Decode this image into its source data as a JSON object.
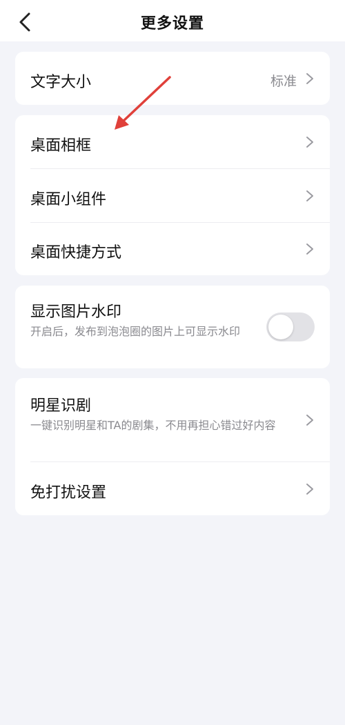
{
  "header": {
    "title": "更多设置",
    "back_icon": "chevron-left-icon"
  },
  "cards": {
    "font_size": {
      "title": "文字大小",
      "value": "标准"
    },
    "desktop": {
      "items": [
        {
          "title": "桌面相框"
        },
        {
          "title": "桌面小组件"
        },
        {
          "title": "桌面快捷方式"
        }
      ]
    },
    "watermark": {
      "title": "显示图片水印",
      "desc": "开启后，发布到泡泡圈的图片上可显示水印",
      "enabled": false
    },
    "misc": {
      "star": {
        "title": "明星识剧",
        "desc": "一键识别明星和TA的剧集，不用再担心错过好内容"
      },
      "dnd": {
        "title": "免打扰设置"
      }
    }
  },
  "colors": {
    "background": "#f3f4f9",
    "card": "#ffffff",
    "secondary_text": "#8a8a8f",
    "annotation_arrow": "#e0403a"
  }
}
